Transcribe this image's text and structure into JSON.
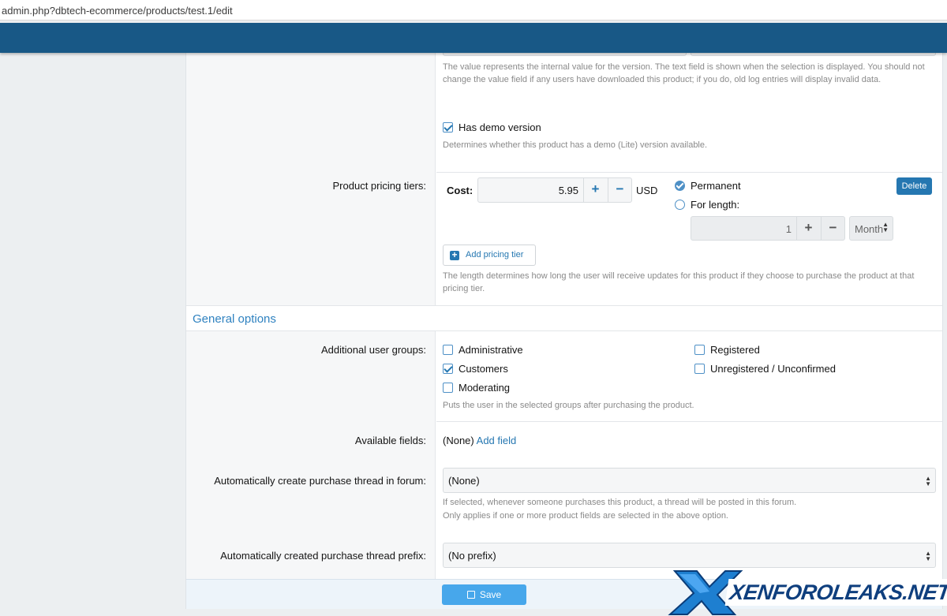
{
  "browser": {
    "url": "admin.php?dbtech-ecommerce/products/test.1/edit"
  },
  "version_section": {
    "explain": "The value represents the internal value for the version. The text field is shown when the selection is displayed. You should not change the value field if any users have downloaded this product; if you do, old log entries will display invalid data.",
    "has_demo_label": "Has demo version",
    "has_demo_checked": true,
    "has_demo_explain": "Determines whether this product has a demo (Lite) version available."
  },
  "pricing": {
    "label": "Product pricing tiers:",
    "cost_label": "Cost:",
    "cost_value": "5.95",
    "currency": "USD",
    "permanent_label": "Permanent",
    "for_length_label": "For length:",
    "length_value": "1",
    "length_unit": "Month",
    "delete_label": "Delete",
    "add_tier_label": "Add pricing tier",
    "explain": "The length determines how long the user will receive updates for this product if they choose to purchase the product at that pricing tier."
  },
  "general": {
    "heading": "General options",
    "groups_label": "Additional user groups:",
    "groups": [
      {
        "label": "Administrative",
        "checked": false
      },
      {
        "label": "Customers",
        "checked": true
      },
      {
        "label": "Moderating",
        "checked": false
      },
      {
        "label": "Registered",
        "checked": false
      },
      {
        "label": "Unregistered / Unconfirmed",
        "checked": false
      }
    ],
    "groups_explain": "Puts the user in the selected groups after purchasing the product.",
    "fields_label": "Available fields:",
    "fields_value": "(None)",
    "add_field_label": "Add field",
    "thread_forum_label": "Automatically create purchase thread in forum:",
    "thread_forum_value": "(None)",
    "thread_forum_explain_1": "If selected, whenever someone purchases this product, a thread will be posted in this forum.",
    "thread_forum_explain_2": "Only applies if one or more product fields are selected in the above option.",
    "thread_prefix_label": "Automatically created purchase thread prefix:",
    "thread_prefix_value": "(No prefix)"
  },
  "footer": {
    "save_label": "Save"
  },
  "watermark": {
    "text": "XENFOROLEAKS.NET"
  },
  "colors": {
    "topbar": "#185886",
    "accent": "#2577b1",
    "link": "#2577b1"
  }
}
